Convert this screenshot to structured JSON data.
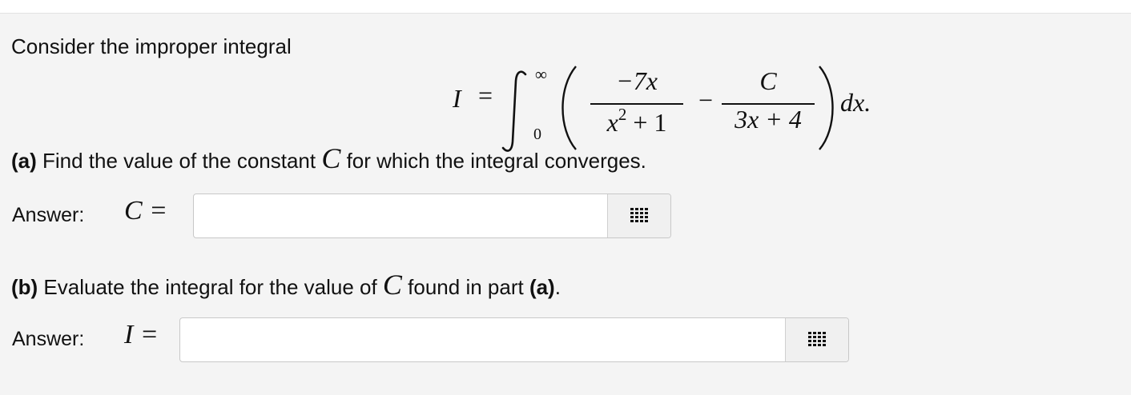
{
  "intro_text": "Consider the improper integral",
  "equation": {
    "lhs": "I",
    "equals": "=",
    "upper_limit": "∞",
    "lower_limit": "0",
    "frac1_num": "−7x",
    "frac1_den_base": "x",
    "frac1_den_exp": "2",
    "frac1_den_rest": " + 1",
    "minus": "−",
    "frac2_num": "C",
    "frac2_den": "3x + 4",
    "differential": "dx."
  },
  "part_a": {
    "label": "(a)",
    "text_before": " Find the value of the constant ",
    "variable": "C",
    "text_after": " for which the integral converges."
  },
  "part_b": {
    "label": "(b)",
    "text_before": " Evaluate the integral for the value of ",
    "variable": "C",
    "text_mid": " found in part ",
    "ref": "(a)",
    "text_after": "."
  },
  "answer_a": {
    "label": "Answer:",
    "var": "C =",
    "value": ""
  },
  "answer_b": {
    "label": "Answer:",
    "var": "I =",
    "value": ""
  },
  "icons": {
    "keypad": "keypad-icon"
  }
}
